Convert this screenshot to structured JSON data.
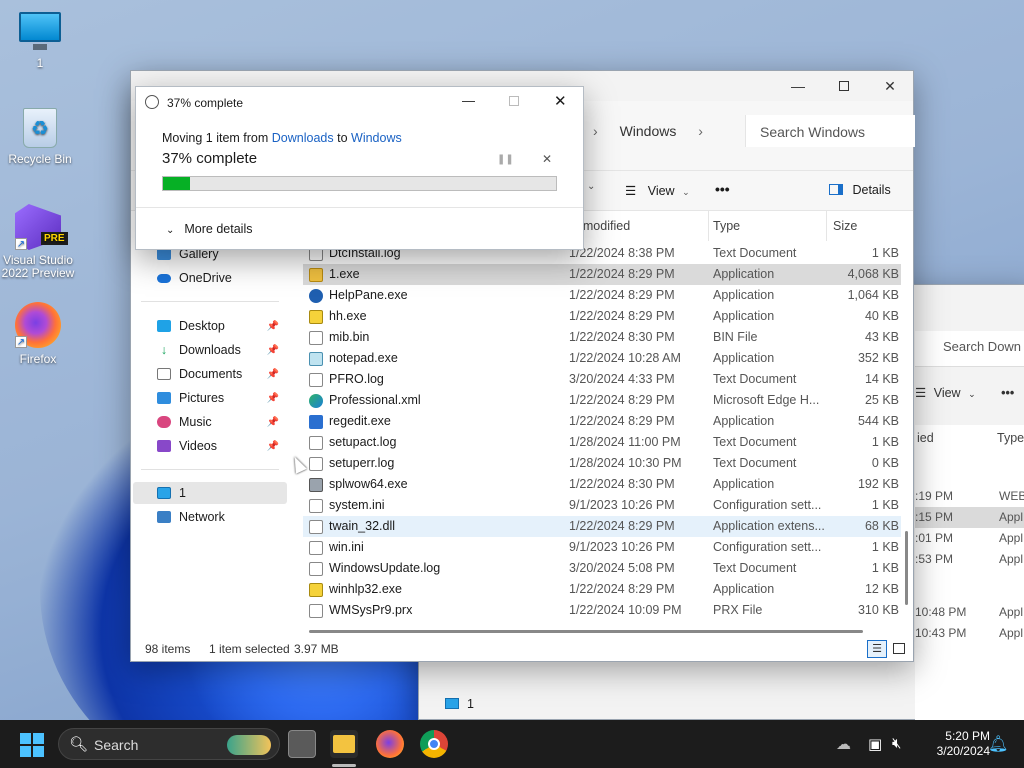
{
  "desktop": {
    "icons": [
      {
        "label": "1"
      },
      {
        "label": "Recycle Bin"
      },
      {
        "label": "Visual Studio 2022 Preview",
        "badge": "PRE"
      },
      {
        "label": "Firefox"
      }
    ]
  },
  "bg_window": {
    "search_placeholder": "Search Down",
    "view_label": "View",
    "col_modified": "ied",
    "col_type": "Type",
    "rows": [
      {
        "time": ":19 PM",
        "type": "WEB"
      },
      {
        "time": ":15 PM",
        "type": "Appl"
      },
      {
        "time": ":01 PM",
        "type": "Appl"
      },
      {
        "time": ":53 PM",
        "type": "Appl"
      },
      {
        "time": "10:48 PM",
        "type": "Appl"
      },
      {
        "time": "10:43 PM",
        "type": "Appl"
      }
    ],
    "nav_item": "1"
  },
  "explorer": {
    "breadcrumb": {
      "current": "Windows"
    },
    "search_placeholder": "Search Windows",
    "toolbar": {
      "view_label": "View",
      "more_label": "•••",
      "details_label": "Details"
    },
    "columns": {
      "modified": "te modified",
      "type": "Type",
      "size": "Size"
    },
    "nav": {
      "gallery": "Gallery",
      "onedrive": "OneDrive",
      "desktop": "Desktop",
      "downloads": "Downloads",
      "documents": "Documents",
      "pictures": "Pictures",
      "music": "Music",
      "videos": "Videos",
      "this_pc": "1",
      "network": "Network"
    },
    "files": [
      {
        "name": "DtcInstall.log",
        "date": "1/22/2024 8:38 PM",
        "type": "Text Document",
        "size": "1 KB"
      },
      {
        "name": "1.exe",
        "date": "1/22/2024 8:29 PM",
        "type": "Application",
        "size": "4,068 KB"
      },
      {
        "name": "HelpPane.exe",
        "date": "1/22/2024 8:29 PM",
        "type": "Application",
        "size": "1,064 KB"
      },
      {
        "name": "hh.exe",
        "date": "1/22/2024 8:29 PM",
        "type": "Application",
        "size": "40 KB"
      },
      {
        "name": "mib.bin",
        "date": "1/22/2024 8:30 PM",
        "type": "BIN File",
        "size": "43 KB"
      },
      {
        "name": "notepad.exe",
        "date": "1/22/2024 10:28 AM",
        "type": "Application",
        "size": "352 KB"
      },
      {
        "name": "PFRO.log",
        "date": "3/20/2024 4:33 PM",
        "type": "Text Document",
        "size": "14 KB"
      },
      {
        "name": "Professional.xml",
        "date": "1/22/2024 8:29 PM",
        "type": "Microsoft Edge H...",
        "size": "25 KB"
      },
      {
        "name": "regedit.exe",
        "date": "1/22/2024 8:29 PM",
        "type": "Application",
        "size": "544 KB"
      },
      {
        "name": "setupact.log",
        "date": "1/28/2024 11:00 PM",
        "type": "Text Document",
        "size": "1 KB"
      },
      {
        "name": "setuperr.log",
        "date": "1/28/2024 10:30 PM",
        "type": "Text Document",
        "size": "0 KB"
      },
      {
        "name": "splwow64.exe",
        "date": "1/22/2024 8:30 PM",
        "type": "Application",
        "size": "192 KB"
      },
      {
        "name": "system.ini",
        "date": "9/1/2023 10:26 PM",
        "type": "Configuration sett...",
        "size": "1 KB"
      },
      {
        "name": "twain_32.dll",
        "date": "1/22/2024 8:29 PM",
        "type": "Application extens...",
        "size": "68 KB"
      },
      {
        "name": "win.ini",
        "date": "9/1/2023 10:26 PM",
        "type": "Configuration sett...",
        "size": "1 KB"
      },
      {
        "name": "WindowsUpdate.log",
        "date": "3/20/2024 5:08 PM",
        "type": "Text Document",
        "size": "1 KB"
      },
      {
        "name": "winhlp32.exe",
        "date": "1/22/2024 8:29 PM",
        "type": "Application",
        "size": "12 KB"
      },
      {
        "name": "WMSysPr9.prx",
        "date": "1/22/2024 10:09 PM",
        "type": "PRX File",
        "size": "310 KB"
      }
    ],
    "status": {
      "count": "98 items",
      "selected": "1 item selected",
      "selected_size": "3.97 MB"
    }
  },
  "dialog": {
    "title": "37% complete",
    "moving_prefix": "Moving 1 item from",
    "from": "Downloads",
    "to_word": "to",
    "to": "Windows",
    "heading": "37% complete",
    "progress": 0.068,
    "more_details": "More details",
    "accent": "#06b025"
  },
  "taskbar": {
    "search_placeholder": "Search",
    "time": "5:20 PM",
    "date": "3/20/2024"
  }
}
